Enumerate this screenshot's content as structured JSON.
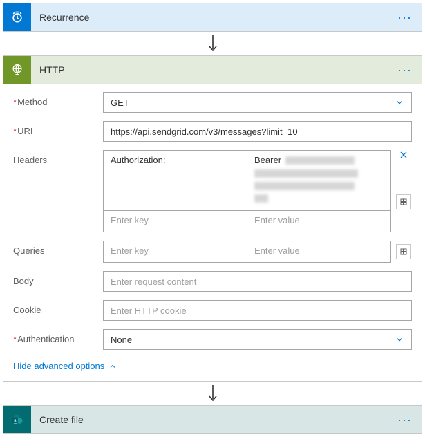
{
  "recurrence": {
    "title": "Recurrence"
  },
  "http": {
    "title": "HTTP",
    "fields": {
      "method_label": "Method",
      "method_value": "GET",
      "uri_label": "URI",
      "uri_value": "https://api.sendgrid.com/v3/messages?limit=10",
      "headers_label": "Headers",
      "headers_key": "Authorization:",
      "headers_value_prefix": "Bearer",
      "headers_key_ph": "Enter key",
      "headers_value_ph": "Enter value",
      "queries_label": "Queries",
      "queries_key_ph": "Enter key",
      "queries_value_ph": "Enter value",
      "body_label": "Body",
      "body_ph": "Enter request content",
      "cookie_label": "Cookie",
      "cookie_ph": "Enter HTTP cookie",
      "auth_label": "Authentication",
      "auth_value": "None"
    },
    "adv_toggle": "Hide advanced options"
  },
  "createfile": {
    "title": "Create file"
  }
}
